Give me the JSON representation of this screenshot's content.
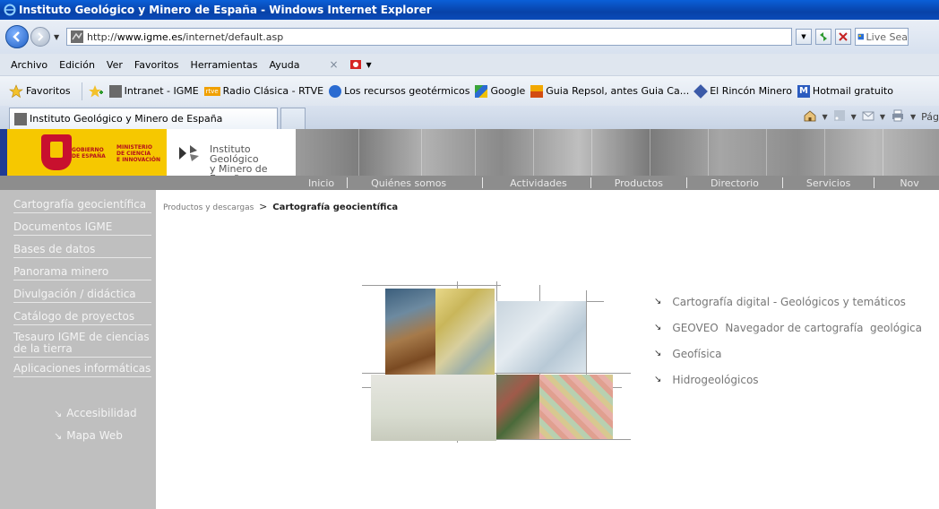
{
  "window": {
    "title": "Instituto Geológico y Minero de España - Windows Internet Explorer"
  },
  "address": {
    "url_prefix": "http://",
    "url_domain": "www.igme.es",
    "url_path": "/internet/default.asp",
    "search_placeholder": "Live Sea"
  },
  "menu": {
    "items": [
      "Archivo",
      "Edición",
      "Ver",
      "Favoritos",
      "Herramientas",
      "Ayuda"
    ]
  },
  "favorites": {
    "label": "Favoritos",
    "items": [
      {
        "label": "Intranet - IGME",
        "icon": "igme-icon",
        "color": "#6a6a6a"
      },
      {
        "label": "Radio Clásica - RTVE",
        "icon": "rtve-icon",
        "color": "#f0a000"
      },
      {
        "label": "Los recursos geotérmicos",
        "icon": "ie-page-icon",
        "color": "#2a6bd1"
      },
      {
        "label": "Google",
        "icon": "google-icon",
        "color": "#3aa53a"
      },
      {
        "label": "Guia Repsol, antes Guia Ca...",
        "icon": "repsol-icon",
        "color": "#d24c12"
      },
      {
        "label": "El Rincón Minero",
        "icon": "mineral-icon",
        "color": "#3b5aa8"
      },
      {
        "label": "Hotmail gratuito",
        "icon": "msn-icon",
        "color": "#2a5bbf"
      }
    ]
  },
  "tab": {
    "title": "Instituto Geológico y Minero de España"
  },
  "commandbar": {
    "page_label": "Pág"
  },
  "site": {
    "gov_line1": "GOBIERNO",
    "gov_line2": "DE ESPAÑA",
    "min_line1": "MINISTERIO",
    "min_line2": "DE CIENCIA",
    "min_line3": "E INNOVACIÓN",
    "logo_line1": "Instituto Geológico",
    "logo_line2": "y Minero de España",
    "nav": [
      "Inicio",
      "Quiénes somos",
      "Actividades",
      "Productos",
      "Directorio",
      "Servicios",
      "Nov"
    ],
    "sidebar": [
      "Cartografía geocientífica",
      "Documentos IGME",
      "Bases de datos",
      "Panorama minero",
      "Divulgación / didáctica",
      "Catálogo de proyectos",
      "Tesauro IGME de ciencias de la tierra",
      "Aplicaciones informáticas"
    ],
    "sidelinks": [
      "Accesibilidad",
      "Mapa Web"
    ],
    "breadcrumb": {
      "parent": "Productos y descargas",
      "separator": ">",
      "current": "Cartografía geocientífica"
    },
    "links": [
      "Cartografía digital - Geológicos y temáticos",
      "GEOVEO  Navegador de cartografía  geológica",
      "Geofísica",
      "Hidrogeológicos"
    ]
  }
}
